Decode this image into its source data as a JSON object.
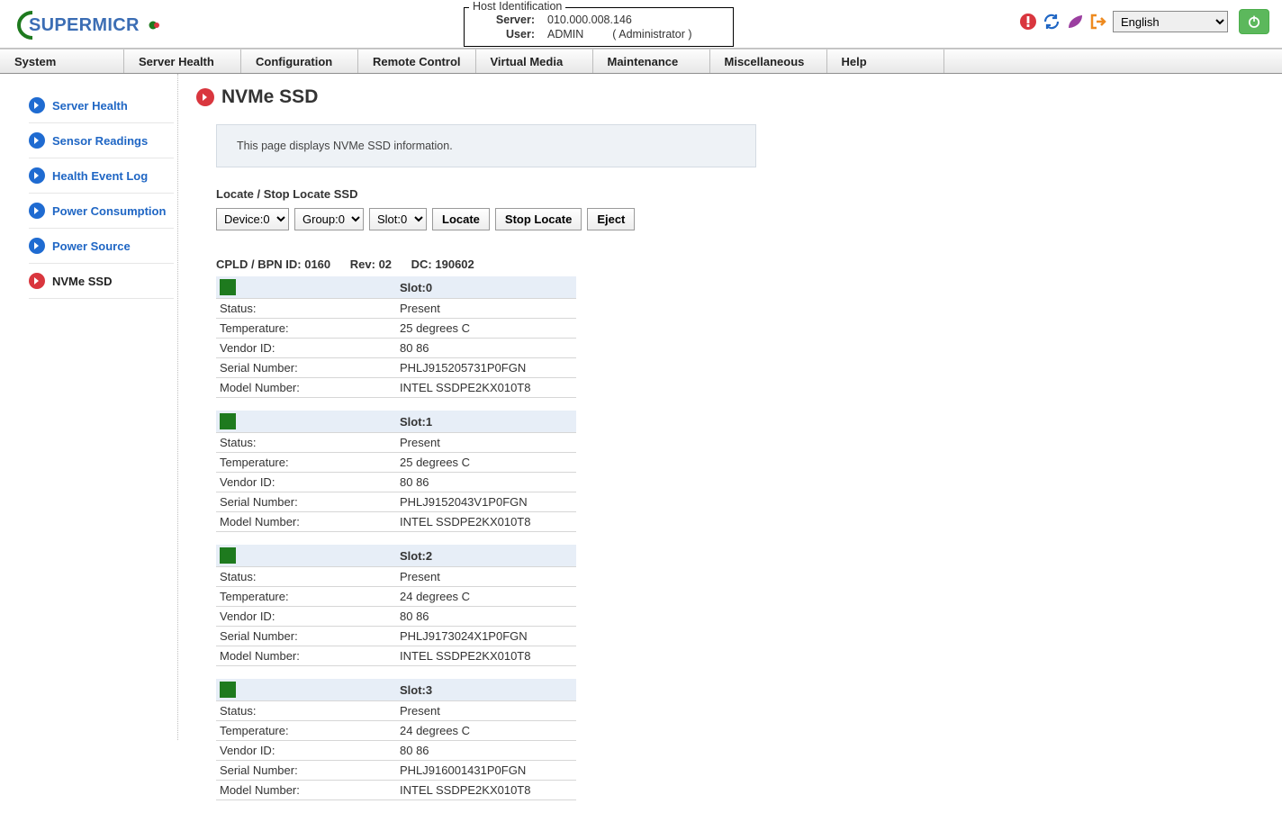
{
  "hostId": {
    "legend": "Host Identification",
    "serverLabel": "Server:",
    "server": "010.000.008.146",
    "userLabel": "User:",
    "user": "ADMIN",
    "role": "( Administrator )"
  },
  "topbar": {
    "language": "English",
    "languageOptions": [
      "English"
    ]
  },
  "nav": [
    "System",
    "Server Health",
    "Configuration",
    "Remote Control",
    "Virtual Media",
    "Maintenance",
    "Miscellaneous",
    "Help"
  ],
  "sidebar": [
    {
      "label": "Server Health",
      "active": false
    },
    {
      "label": "Sensor Readings",
      "active": false
    },
    {
      "label": "Health Event Log",
      "active": false
    },
    {
      "label": "Power Consumption",
      "active": false
    },
    {
      "label": "Power Source",
      "active": false
    },
    {
      "label": "NVMe SSD",
      "active": true
    }
  ],
  "page": {
    "title": "NVMe SSD",
    "info": "This page displays NVMe SSD information.",
    "locateLabel": "Locate / Stop Locate SSD",
    "selects": {
      "device": "Device:0",
      "group": "Group:0",
      "slot": "Slot:0"
    },
    "buttons": {
      "locate": "Locate",
      "stop": "Stop Locate",
      "eject": "Eject"
    },
    "cpld": {
      "id": "CPLD / BPN ID: 0160",
      "rev": "Rev: 02",
      "dc": "DC: 190602"
    },
    "fieldLabels": {
      "status": "Status:",
      "temp": "Temperature:",
      "vendor": "Vendor ID:",
      "serial": "Serial Number:",
      "model": "Model Number:"
    },
    "slots": [
      {
        "slot": "Slot:0",
        "status": "Present",
        "temp": "25 degrees C",
        "vendor": "80 86",
        "serial": "PHLJ915205731P0FGN",
        "model": "INTEL SSDPE2KX010T8"
      },
      {
        "slot": "Slot:1",
        "status": "Present",
        "temp": "25 degrees C",
        "vendor": "80 86",
        "serial": "PHLJ9152043V1P0FGN",
        "model": "INTEL SSDPE2KX010T8"
      },
      {
        "slot": "Slot:2",
        "status": "Present",
        "temp": "24 degrees C",
        "vendor": "80 86",
        "serial": "PHLJ9173024X1P0FGN",
        "model": "INTEL SSDPE2KX010T8"
      },
      {
        "slot": "Slot:3",
        "status": "Present",
        "temp": "24 degrees C",
        "vendor": "80 86",
        "serial": "PHLJ916001431P0FGN",
        "model": "INTEL SSDPE2KX010T8"
      }
    ]
  }
}
